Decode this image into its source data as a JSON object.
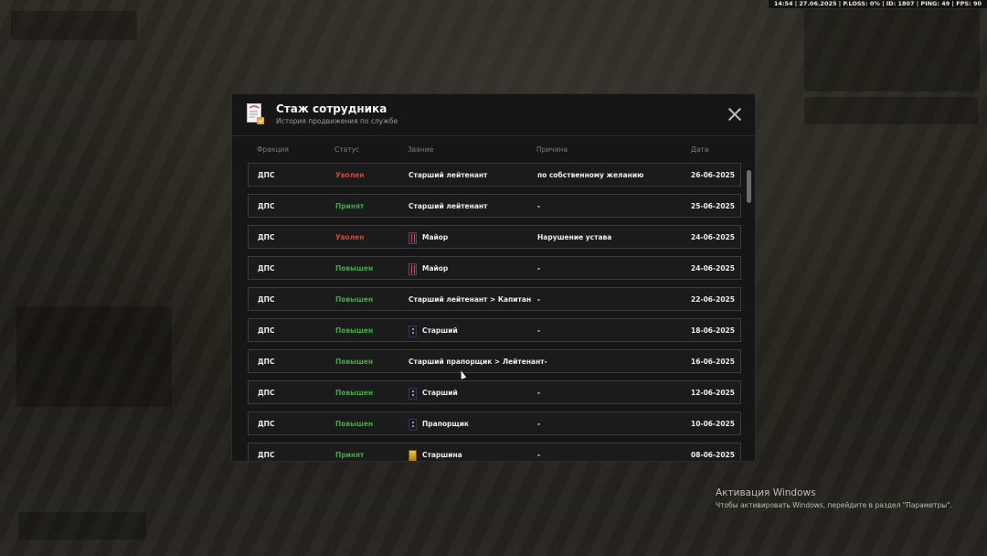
{
  "hud": {
    "status": "14:54 | 27.06.2025 | P.LOSS: 0% | ID: 1807 | PING: 49 | FPS: 90"
  },
  "modal": {
    "title": "Стаж сотрудника",
    "subtitle": "История продвижения по службе",
    "columns": {
      "faction": "Фракция",
      "status": "Статус",
      "rank": "Звание",
      "reason": "Причина",
      "date": "Дата"
    },
    "rows": [
      {
        "faction": "ДПС",
        "status": "Уволен",
        "status_type": "fired",
        "rank": "Старший лейтенант",
        "rank_icon": "none",
        "reason": "по собственному желанию",
        "date": "26-06-2025"
      },
      {
        "faction": "ДПС",
        "status": "Принят",
        "status_type": "ok",
        "rank": "Старший лейтенант",
        "rank_icon": "none",
        "reason": "-",
        "date": "25-06-2025"
      },
      {
        "faction": "ДПС",
        "status": "Уволен",
        "status_type": "fired",
        "rank": "Майор",
        "rank_icon": "major",
        "reason": "Нарушение устава",
        "date": "24-06-2025"
      },
      {
        "faction": "ДПС",
        "status": "Повышен",
        "status_type": "ok",
        "rank": "Майор",
        "rank_icon": "major",
        "reason": "-",
        "date": "24-06-2025"
      },
      {
        "faction": "ДПС",
        "status": "Повышен",
        "status_type": "ok",
        "rank": "Старший лейтенант > Капитан",
        "rank_icon": "none",
        "reason": "-",
        "date": "22-06-2025"
      },
      {
        "faction": "ДПС",
        "status": "Повышен",
        "status_type": "ok",
        "rank": "Старший",
        "rank_icon": "star",
        "reason": "-",
        "date": "18-06-2025"
      },
      {
        "faction": "ДПС",
        "status": "Повышен",
        "status_type": "ok",
        "rank": "Старший прапорщик > Лейтенант-",
        "rank_icon": "none",
        "reason": "",
        "date": "16-06-2025"
      },
      {
        "faction": "ДПС",
        "status": "Повышен",
        "status_type": "ok",
        "rank": "Старший",
        "rank_icon": "star",
        "reason": "-",
        "date": "12-06-2025"
      },
      {
        "faction": "ДПС",
        "status": "Повышен",
        "status_type": "ok",
        "rank": "Прапорщик",
        "rank_icon": "star",
        "reason": "-",
        "date": "10-06-2025"
      },
      {
        "faction": "ДПС",
        "status": "Принят",
        "status_type": "ok",
        "rank": "Старшина",
        "rank_icon": "gold",
        "reason": "-",
        "date": "08-06-2025"
      }
    ]
  },
  "activation": {
    "title": "Активация Windows",
    "text": "Чтобы активировать Windows, перейдите в раздел \"Параметры\"."
  },
  "icons": {
    "header": "document-icon",
    "close": "close-icon"
  },
  "colors": {
    "fired": "#c84a3c",
    "ok": "#3fa844"
  }
}
